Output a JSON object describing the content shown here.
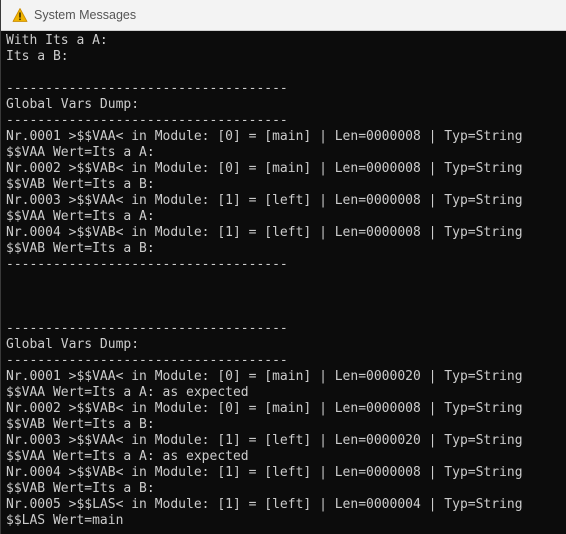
{
  "window": {
    "title": "System Messages",
    "icon": "warning-triangle-icon"
  },
  "console": {
    "lines": [
      "With Its a A:",
      "Its a B:",
      "",
      "------------------------------------",
      "Global Vars Dump:",
      "------------------------------------",
      "Nr.0001 >$$VAA< in Module: [0] = [main] | Len=0000008 | Typ=String",
      "$$VAA Wert=Its a A:",
      "Nr.0002 >$$VAB< in Module: [0] = [main] | Len=0000008 | Typ=String",
      "$$VAB Wert=Its a B:",
      "Nr.0003 >$$VAA< in Module: [1] = [left] | Len=0000008 | Typ=String",
      "$$VAA Wert=Its a A:",
      "Nr.0004 >$$VAB< in Module: [1] = [left] | Len=0000008 | Typ=String",
      "$$VAB Wert=Its a B:",
      "------------------------------------",
      "",
      "",
      "",
      "------------------------------------",
      "Global Vars Dump:",
      "------------------------------------",
      "Nr.0001 >$$VAA< in Module: [0] = [main] | Len=0000020 | Typ=String",
      "$$VAA Wert=Its a A: as expected",
      "Nr.0002 >$$VAB< in Module: [0] = [main] | Len=0000008 | Typ=String",
      "$$VAB Wert=Its a B:",
      "Nr.0003 >$$VAA< in Module: [1] = [left] | Len=0000020 | Typ=String",
      "$$VAA Wert=Its a A: as expected",
      "Nr.0004 >$$VAB< in Module: [1] = [left] | Len=0000008 | Typ=String",
      "$$VAB Wert=Its a B:",
      "Nr.0005 >$$LAS< in Module: [1] = [left] | Len=0000004 | Typ=String",
      "$$LAS Wert=main",
      "------------------------------------"
    ]
  }
}
